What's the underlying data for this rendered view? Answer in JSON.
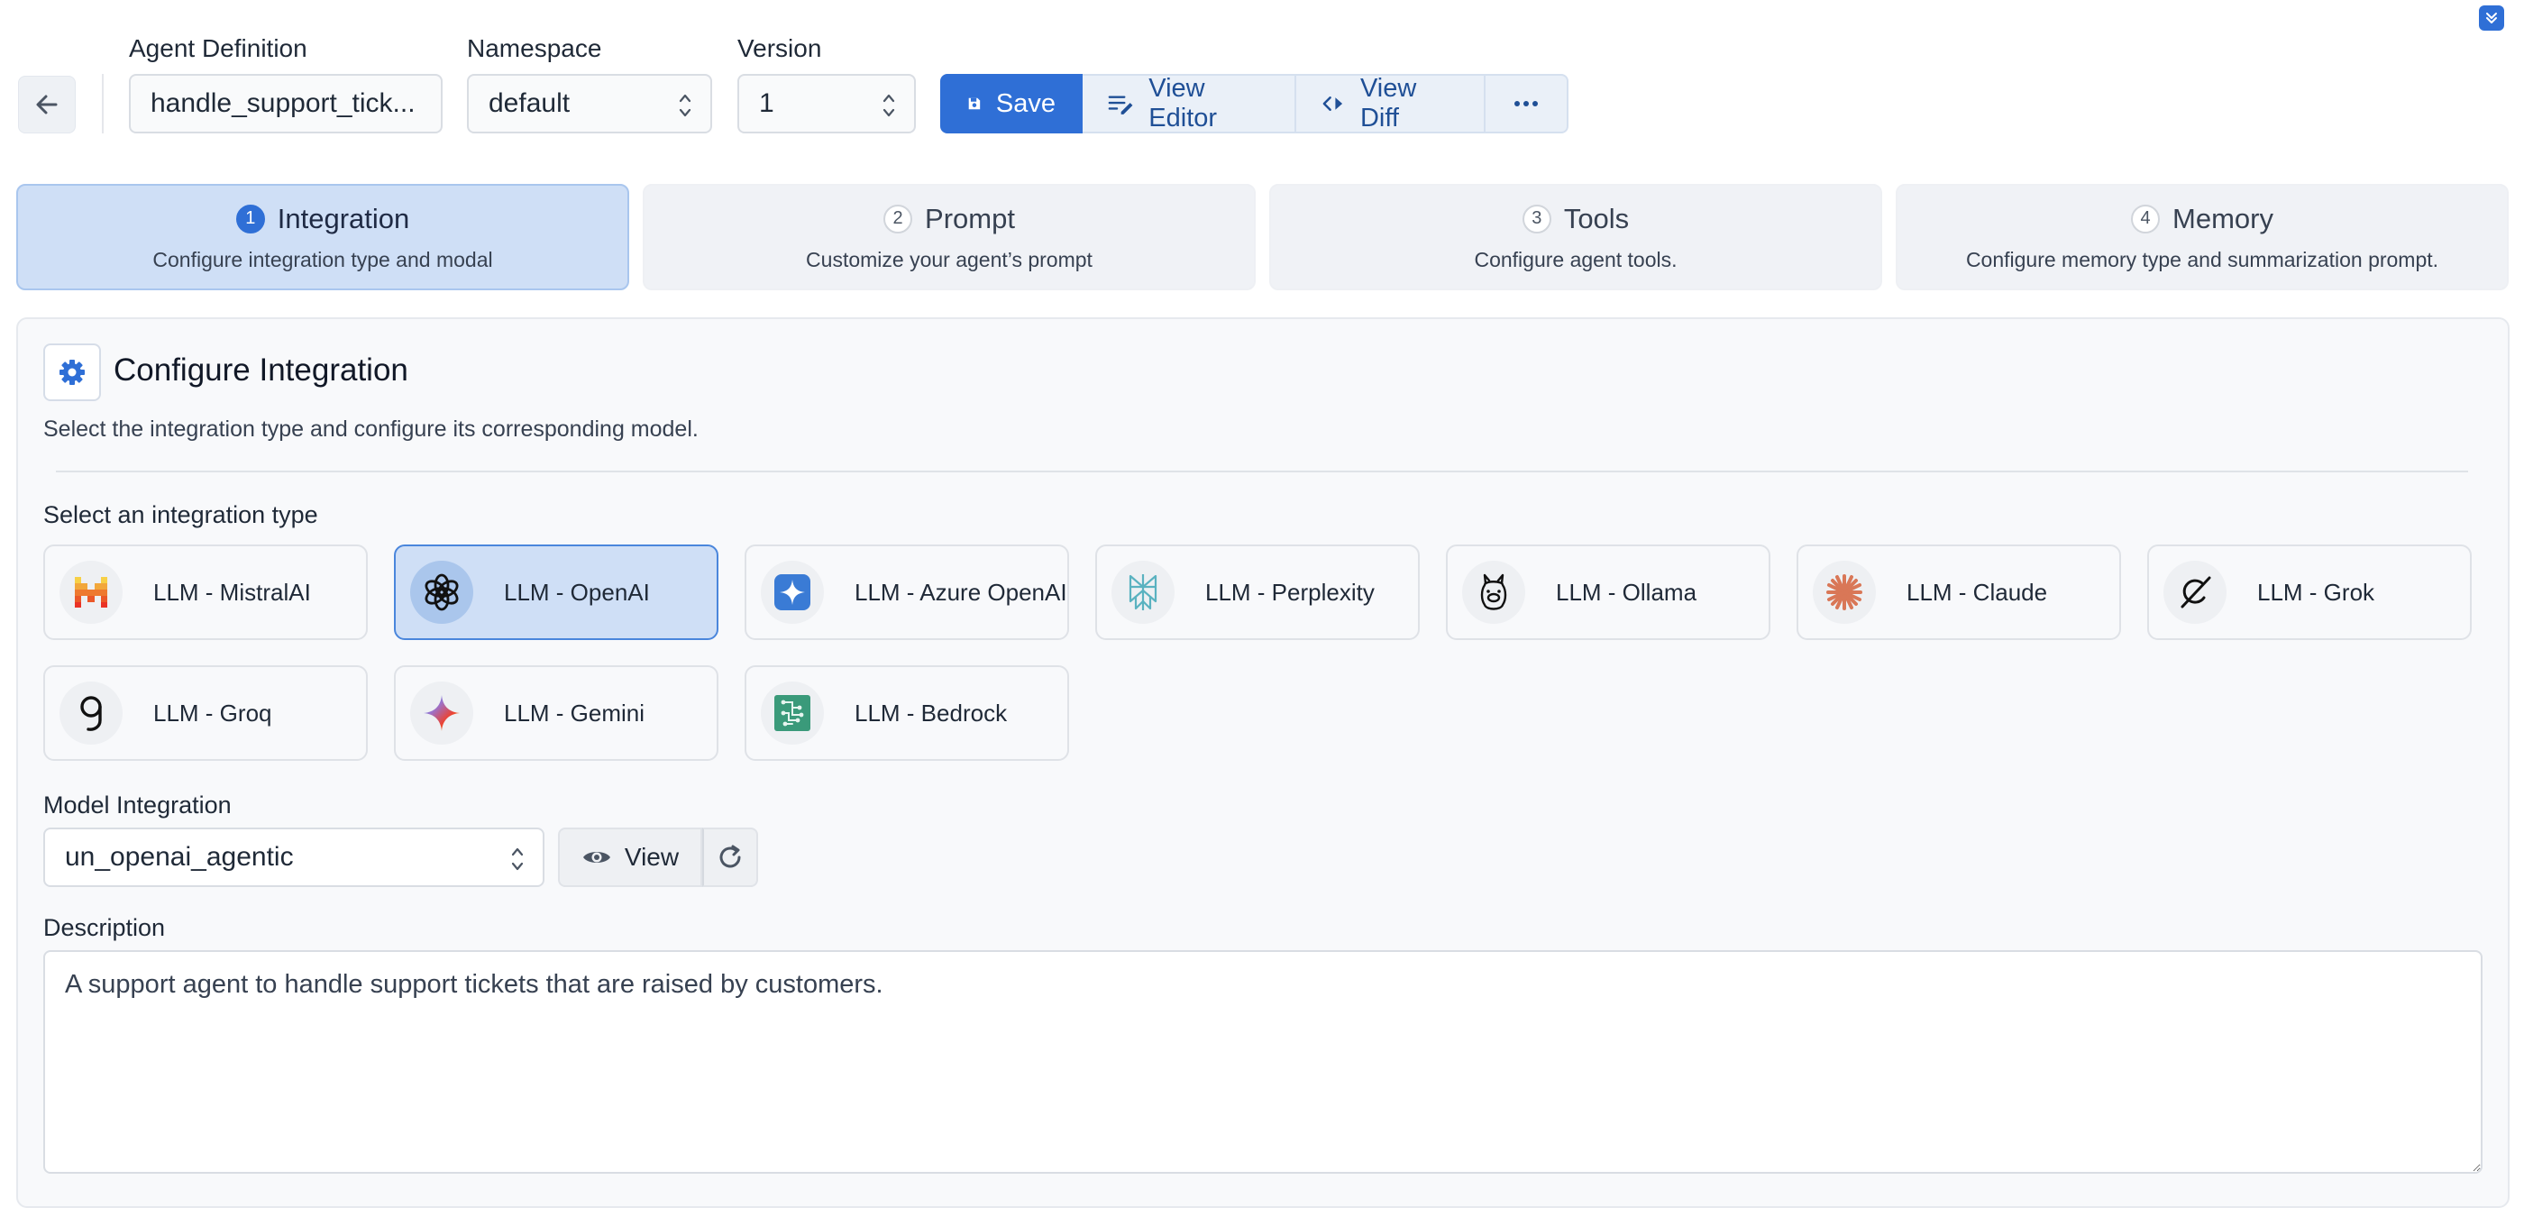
{
  "header": {
    "back_icon": "arrow-left-icon",
    "corner_icon": "chevron-down-icon",
    "agent_definition": {
      "label": "Agent Definition",
      "value": "handle_support_tick..."
    },
    "namespace": {
      "label": "Namespace",
      "value": "default"
    },
    "version": {
      "label": "Version",
      "value": "1"
    },
    "actions": {
      "save": "Save",
      "view_editor": "View Editor",
      "view_diff": "View Diff",
      "more": "more-horizontal-icon"
    }
  },
  "steps": [
    {
      "num": "1",
      "title": "Integration",
      "subtitle": "Configure integration type and modal",
      "active": true
    },
    {
      "num": "2",
      "title": "Prompt",
      "subtitle": "Customize your agent’s prompt",
      "active": false
    },
    {
      "num": "3",
      "title": "Tools",
      "subtitle": "Configure agent tools.",
      "active": false
    },
    {
      "num": "4",
      "title": "Memory",
      "subtitle": "Configure memory type and summarization prompt.",
      "active": false
    }
  ],
  "panel": {
    "title": "Configure Integration",
    "description": "Select the integration type and configure its corresponding model.",
    "integration_label": "Select an integration type",
    "integrations": [
      {
        "label": "LLM - MistralAI",
        "icon": "mistral-icon",
        "selected": false
      },
      {
        "label": "LLM - OpenAI",
        "icon": "openai-icon",
        "selected": true
      },
      {
        "label": "LLM - Azure OpenAI",
        "icon": "azure-openai-icon",
        "selected": false
      },
      {
        "label": "LLM - Perplexity",
        "icon": "perplexity-icon",
        "selected": false
      },
      {
        "label": "LLM - Ollama",
        "icon": "ollama-icon",
        "selected": false
      },
      {
        "label": "LLM - Claude",
        "icon": "claude-icon",
        "selected": false
      },
      {
        "label": "LLM - Grok",
        "icon": "grok-icon",
        "selected": false
      },
      {
        "label": "LLM - Groq",
        "icon": "groq-icon",
        "selected": false
      },
      {
        "label": "LLM - Gemini",
        "icon": "gemini-icon",
        "selected": false
      },
      {
        "label": "LLM - Bedrock",
        "icon": "bedrock-icon",
        "selected": false
      }
    ],
    "model_integration": {
      "label": "Model Integration",
      "value": "un_openai_agentic",
      "view_label": "View"
    },
    "description_field": {
      "label": "Description",
      "value": "A support agent to handle support tickets that are raised by customers."
    }
  },
  "colors": {
    "primary": "#2f6fd6",
    "selected_bg": "#cfdff6",
    "claude": "#d97757",
    "bedrock": "#3a9a7a"
  }
}
